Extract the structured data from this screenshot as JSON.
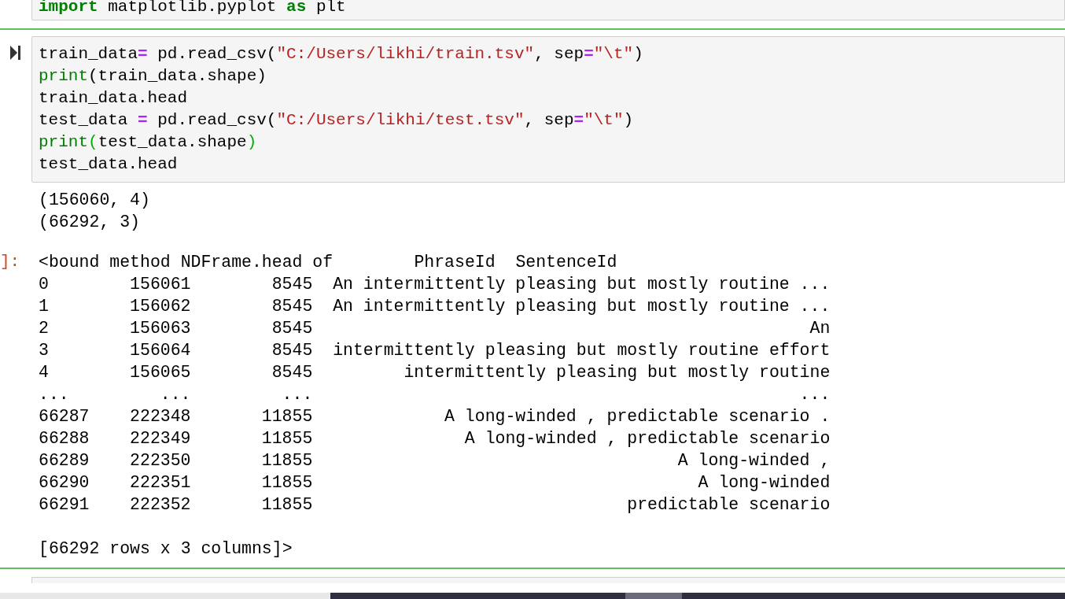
{
  "cells": [
    {
      "kind": "code",
      "selected": false,
      "lines": [
        [
          {
            "kind": "keyword",
            "text": "import"
          },
          {
            "kind": "plain",
            "text": " matplotlib.pyplot "
          },
          {
            "kind": "keyword",
            "text": "as"
          },
          {
            "kind": "plain",
            "text": " plt"
          }
        ]
      ]
    },
    {
      "kind": "code",
      "selected": true,
      "lines": [
        [
          {
            "kind": "plain",
            "text": "train_data"
          },
          {
            "kind": "operator",
            "text": "="
          },
          {
            "kind": "plain",
            "text": " pd.read_csv("
          },
          {
            "kind": "string",
            "text": "\"C:/Users/likhi/train.tsv\""
          },
          {
            "kind": "plain",
            "text": ", sep"
          },
          {
            "kind": "operator",
            "text": "="
          },
          {
            "kind": "string",
            "text": "\"\\t\""
          },
          {
            "kind": "plain",
            "text": ")"
          }
        ],
        [
          {
            "kind": "builtin",
            "text": "print"
          },
          {
            "kind": "plain",
            "text": "(train_data.shape)"
          }
        ],
        [
          {
            "kind": "plain",
            "text": "train_data.head"
          }
        ],
        [
          {
            "kind": "plain",
            "text": "test_data "
          },
          {
            "kind": "operator",
            "text": "="
          },
          {
            "kind": "plain",
            "text": " pd.read_csv("
          },
          {
            "kind": "string",
            "text": "\"C:/Users/likhi/test.tsv\""
          },
          {
            "kind": "plain",
            "text": ", sep"
          },
          {
            "kind": "operator",
            "text": "="
          },
          {
            "kind": "string",
            "text": "\"\\t\""
          },
          {
            "kind": "plain",
            "text": ")"
          }
        ],
        [
          {
            "kind": "builtin",
            "text": "print"
          },
          {
            "kind": "bracket",
            "text": "("
          },
          {
            "kind": "plain",
            "text": "test_data.shape"
          },
          {
            "kind": "bracket",
            "text": ")"
          }
        ],
        [
          {
            "kind": "plain",
            "text": "test_data.head"
          }
        ]
      ],
      "outputs": [
        {
          "kind": "stream",
          "lines": [
            "(156060, 4)",
            "(66292, 3)"
          ]
        },
        {
          "kind": "result",
          "prompt": "]:",
          "header": [
            "<bound method NDFrame.head of",
            "PhraseId",
            "SentenceId"
          ],
          "rows": [
            [
              "0",
              "156061",
              "8545",
              "An intermittently pleasing but mostly routine ..."
            ],
            [
              "1",
              "156062",
              "8545",
              "An intermittently pleasing but mostly routine ..."
            ],
            [
              "2",
              "156063",
              "8545",
              "An"
            ],
            [
              "3",
              "156064",
              "8545",
              "intermittently pleasing but mostly routine effort"
            ],
            [
              "4",
              "156065",
              "8545",
              "intermittently pleasing but mostly routine"
            ],
            [
              "...",
              "...",
              "...",
              "..."
            ],
            [
              "66287",
              "222348",
              "11855",
              "A long-winded , predictable scenario ."
            ],
            [
              "66288",
              "222349",
              "11855",
              "A long-winded , predictable scenario"
            ],
            [
              "66289",
              "222350",
              "11855",
              "A long-winded ,"
            ],
            [
              "66290",
              "222351",
              "11855",
              "A long-winded"
            ],
            [
              "66291",
              "222352",
              "11855",
              "predictable scenario"
            ]
          ],
          "footer": "[66292 rows x 3 columns]>"
        }
      ]
    },
    {
      "kind": "code",
      "selected": false
    }
  ]
}
